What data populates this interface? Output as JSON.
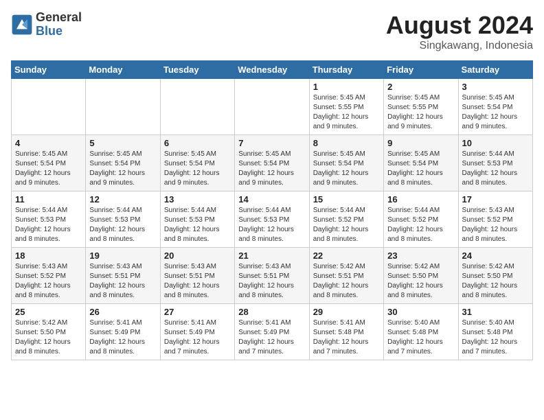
{
  "logo": {
    "general": "General",
    "blue": "Blue"
  },
  "title": {
    "month_year": "August 2024",
    "location": "Singkawang, Indonesia"
  },
  "weekdays": [
    "Sunday",
    "Monday",
    "Tuesday",
    "Wednesday",
    "Thursday",
    "Friday",
    "Saturday"
  ],
  "weeks": [
    [
      {
        "day": "",
        "info": ""
      },
      {
        "day": "",
        "info": ""
      },
      {
        "day": "",
        "info": ""
      },
      {
        "day": "",
        "info": ""
      },
      {
        "day": "1",
        "info": "Sunrise: 5:45 AM\nSunset: 5:55 PM\nDaylight: 12 hours\nand 9 minutes."
      },
      {
        "day": "2",
        "info": "Sunrise: 5:45 AM\nSunset: 5:55 PM\nDaylight: 12 hours\nand 9 minutes."
      },
      {
        "day": "3",
        "info": "Sunrise: 5:45 AM\nSunset: 5:54 PM\nDaylight: 12 hours\nand 9 minutes."
      }
    ],
    [
      {
        "day": "4",
        "info": "Sunrise: 5:45 AM\nSunset: 5:54 PM\nDaylight: 12 hours\nand 9 minutes."
      },
      {
        "day": "5",
        "info": "Sunrise: 5:45 AM\nSunset: 5:54 PM\nDaylight: 12 hours\nand 9 minutes."
      },
      {
        "day": "6",
        "info": "Sunrise: 5:45 AM\nSunset: 5:54 PM\nDaylight: 12 hours\nand 9 minutes."
      },
      {
        "day": "7",
        "info": "Sunrise: 5:45 AM\nSunset: 5:54 PM\nDaylight: 12 hours\nand 9 minutes."
      },
      {
        "day": "8",
        "info": "Sunrise: 5:45 AM\nSunset: 5:54 PM\nDaylight: 12 hours\nand 9 minutes."
      },
      {
        "day": "9",
        "info": "Sunrise: 5:45 AM\nSunset: 5:54 PM\nDaylight: 12 hours\nand 8 minutes."
      },
      {
        "day": "10",
        "info": "Sunrise: 5:44 AM\nSunset: 5:53 PM\nDaylight: 12 hours\nand 8 minutes."
      }
    ],
    [
      {
        "day": "11",
        "info": "Sunrise: 5:44 AM\nSunset: 5:53 PM\nDaylight: 12 hours\nand 8 minutes."
      },
      {
        "day": "12",
        "info": "Sunrise: 5:44 AM\nSunset: 5:53 PM\nDaylight: 12 hours\nand 8 minutes."
      },
      {
        "day": "13",
        "info": "Sunrise: 5:44 AM\nSunset: 5:53 PM\nDaylight: 12 hours\nand 8 minutes."
      },
      {
        "day": "14",
        "info": "Sunrise: 5:44 AM\nSunset: 5:53 PM\nDaylight: 12 hours\nand 8 minutes."
      },
      {
        "day": "15",
        "info": "Sunrise: 5:44 AM\nSunset: 5:52 PM\nDaylight: 12 hours\nand 8 minutes."
      },
      {
        "day": "16",
        "info": "Sunrise: 5:44 AM\nSunset: 5:52 PM\nDaylight: 12 hours\nand 8 minutes."
      },
      {
        "day": "17",
        "info": "Sunrise: 5:43 AM\nSunset: 5:52 PM\nDaylight: 12 hours\nand 8 minutes."
      }
    ],
    [
      {
        "day": "18",
        "info": "Sunrise: 5:43 AM\nSunset: 5:52 PM\nDaylight: 12 hours\nand 8 minutes."
      },
      {
        "day": "19",
        "info": "Sunrise: 5:43 AM\nSunset: 5:51 PM\nDaylight: 12 hours\nand 8 minutes."
      },
      {
        "day": "20",
        "info": "Sunrise: 5:43 AM\nSunset: 5:51 PM\nDaylight: 12 hours\nand 8 minutes."
      },
      {
        "day": "21",
        "info": "Sunrise: 5:43 AM\nSunset: 5:51 PM\nDaylight: 12 hours\nand 8 minutes."
      },
      {
        "day": "22",
        "info": "Sunrise: 5:42 AM\nSunset: 5:51 PM\nDaylight: 12 hours\nand 8 minutes."
      },
      {
        "day": "23",
        "info": "Sunrise: 5:42 AM\nSunset: 5:50 PM\nDaylight: 12 hours\nand 8 minutes."
      },
      {
        "day": "24",
        "info": "Sunrise: 5:42 AM\nSunset: 5:50 PM\nDaylight: 12 hours\nand 8 minutes."
      }
    ],
    [
      {
        "day": "25",
        "info": "Sunrise: 5:42 AM\nSunset: 5:50 PM\nDaylight: 12 hours\nand 8 minutes."
      },
      {
        "day": "26",
        "info": "Sunrise: 5:41 AM\nSunset: 5:49 PM\nDaylight: 12 hours\nand 8 minutes."
      },
      {
        "day": "27",
        "info": "Sunrise: 5:41 AM\nSunset: 5:49 PM\nDaylight: 12 hours\nand 7 minutes."
      },
      {
        "day": "28",
        "info": "Sunrise: 5:41 AM\nSunset: 5:49 PM\nDaylight: 12 hours\nand 7 minutes."
      },
      {
        "day": "29",
        "info": "Sunrise: 5:41 AM\nSunset: 5:48 PM\nDaylight: 12 hours\nand 7 minutes."
      },
      {
        "day": "30",
        "info": "Sunrise: 5:40 AM\nSunset: 5:48 PM\nDaylight: 12 hours\nand 7 minutes."
      },
      {
        "day": "31",
        "info": "Sunrise: 5:40 AM\nSunset: 5:48 PM\nDaylight: 12 hours\nand 7 minutes."
      }
    ]
  ]
}
